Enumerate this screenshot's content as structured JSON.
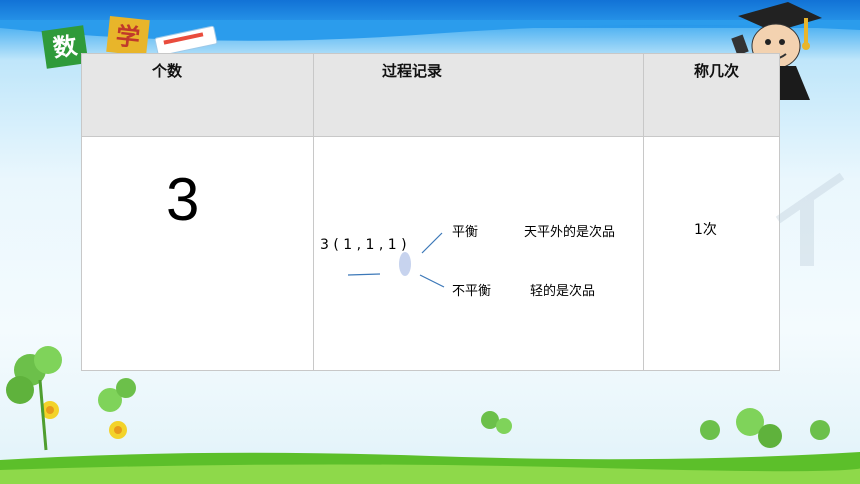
{
  "logo": {
    "char1": "数",
    "char2": "学"
  },
  "table": {
    "headers": [
      "个数",
      "过程记录",
      "称几次"
    ],
    "row": {
      "count": "3",
      "process": {
        "sequence": "3 ( 1 , 1 , 1 )",
        "balanced": "平衡",
        "balanced_result": "天平外的是次品",
        "unbalanced": "不平衡",
        "unbalanced_result": "轻的是次品"
      },
      "times": "1次"
    }
  },
  "colors": {
    "top_band": "#1272d6",
    "grass": "#5cbf2a",
    "header_bg": "#e6e6e6"
  }
}
